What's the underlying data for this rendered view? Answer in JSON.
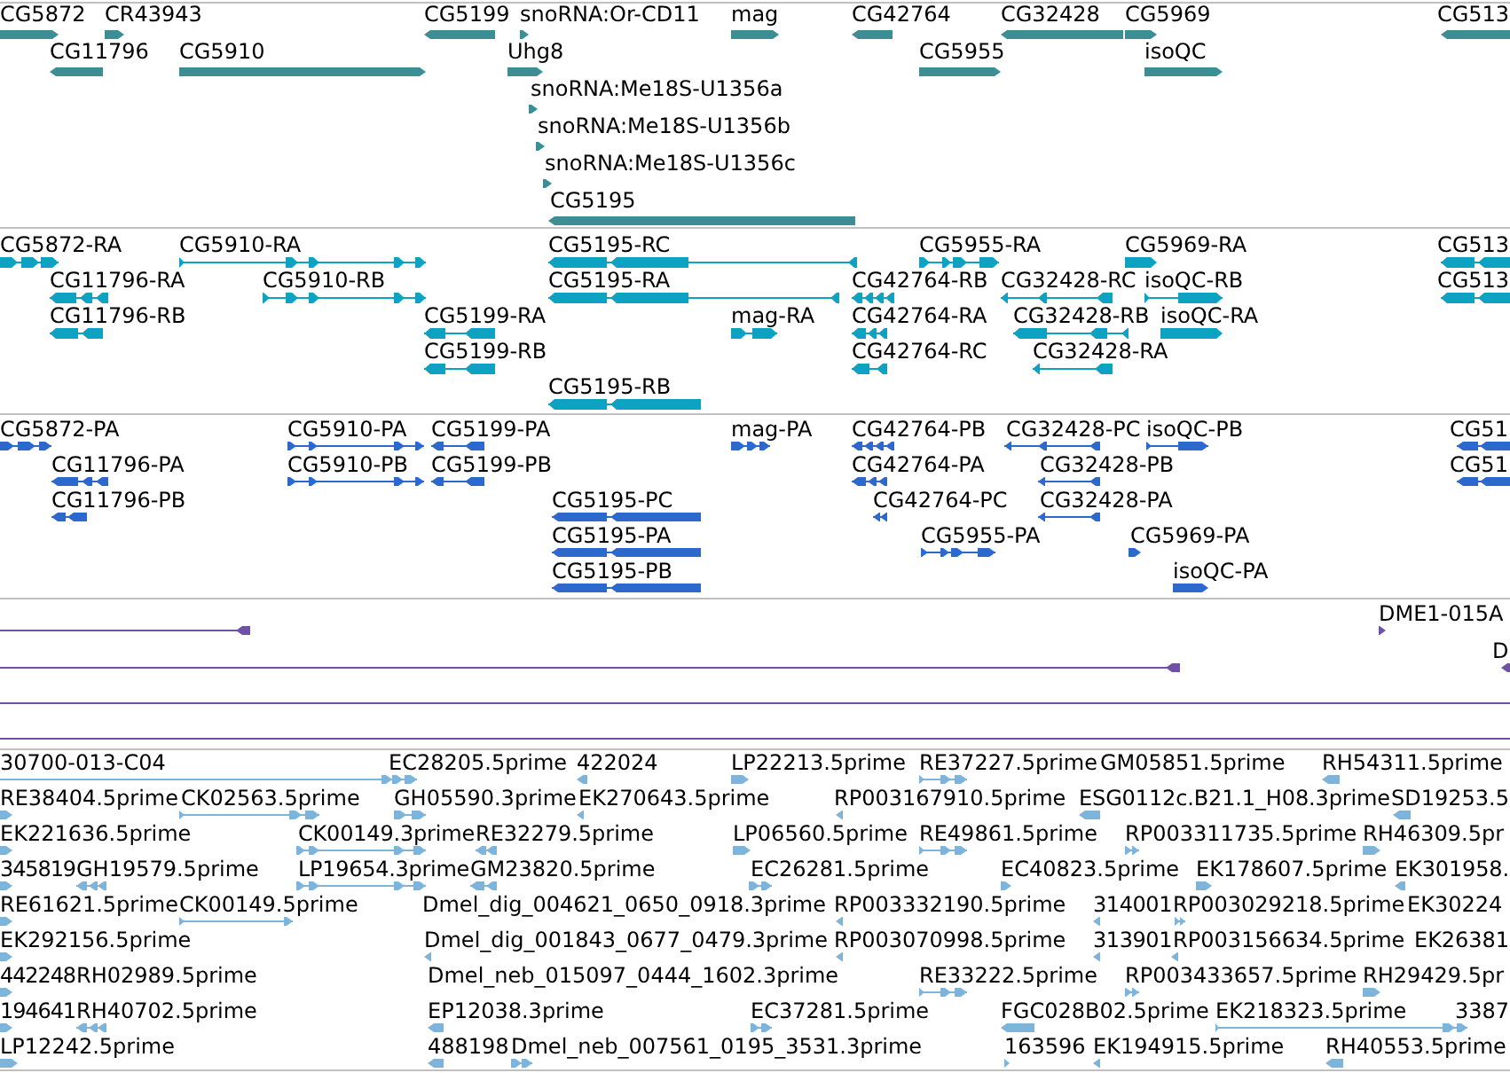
{
  "tracks": [
    {
      "color": "#3d8e94",
      "features": [
        {
          "label": "CG5872",
          "reverse": false
        },
        {
          "label": "CR43943",
          "reverse": false
        },
        {
          "label": "CG5199",
          "reverse": true
        },
        {
          "label": "snoRNA:Or-CD11",
          "reverse": false
        },
        {
          "label": "mag",
          "reverse": false
        },
        {
          "label": "CG42764",
          "reverse": true
        },
        {
          "label": "CG32428",
          "reverse": true
        },
        {
          "label": "CG5969",
          "reverse": false
        },
        {
          "label": "CG513",
          "reverse": true
        },
        {
          "label": "CG11796",
          "reverse": true
        },
        {
          "label": "CG5910",
          "reverse": false
        },
        {
          "label": "Uhg8",
          "reverse": false
        },
        {
          "label": "CG5955",
          "reverse": false
        },
        {
          "label": "isoQC",
          "reverse": false
        },
        {
          "label": "snoRNA:Me18S-U1356a",
          "reverse": false
        },
        {
          "label": "snoRNA:Me18S-U1356b",
          "reverse": false
        },
        {
          "label": "snoRNA:Me18S-U1356c",
          "reverse": false
        },
        {
          "label": "CG5195",
          "reverse": true
        }
      ]
    },
    {
      "color": "#0ea2c2",
      "features": [
        {
          "label": "CG5872-RA",
          "reverse": false
        },
        {
          "label": "CG5910-RA",
          "reverse": false
        },
        {
          "label": "CG5195-RC",
          "reverse": true
        },
        {
          "label": "CG5955-RA",
          "reverse": false
        },
        {
          "label": "CG5969-RA",
          "reverse": false
        },
        {
          "label": "CG513",
          "reverse": true
        },
        {
          "label": "CG11796-RA",
          "reverse": true
        },
        {
          "label": "CG5910-RB",
          "reverse": false
        },
        {
          "label": "CG5195-RA",
          "reverse": true
        },
        {
          "label": "CG42764-RB",
          "reverse": true
        },
        {
          "label": "CG32428-RC",
          "reverse": true
        },
        {
          "label": "isoQC-RB",
          "reverse": false
        },
        {
          "label": "CG513",
          "reverse": true
        },
        {
          "label": "CG11796-RB",
          "reverse": true
        },
        {
          "label": "CG5199-RA",
          "reverse": true
        },
        {
          "label": "mag-RA",
          "reverse": false
        },
        {
          "label": "CG42764-RA",
          "reverse": true
        },
        {
          "label": "CG32428-RB",
          "reverse": true
        },
        {
          "label": "isoQC-RA",
          "reverse": false
        },
        {
          "label": "CG5199-RB",
          "reverse": true
        },
        {
          "label": "CG42764-RC",
          "reverse": true
        },
        {
          "label": "CG32428-RA",
          "reverse": true
        },
        {
          "label": "CG5195-RB",
          "reverse": true
        }
      ]
    },
    {
      "color": "#2d69cd",
      "features": [
        {
          "label": "CG5872-PA",
          "reverse": false
        },
        {
          "label": "CG5910-PA",
          "reverse": false
        },
        {
          "label": "CG5199-PA",
          "reverse": true
        },
        {
          "label": "mag-PA",
          "reverse": false
        },
        {
          "label": "CG42764-PB",
          "reverse": true
        },
        {
          "label": "CG32428-PC",
          "reverse": true
        },
        {
          "label": "isoQC-PB",
          "reverse": false
        },
        {
          "label": "CG51",
          "reverse": true
        },
        {
          "label": "CG11796-PA",
          "reverse": true
        },
        {
          "label": "CG5910-PB",
          "reverse": false
        },
        {
          "label": "CG5199-PB",
          "reverse": true
        },
        {
          "label": "CG42764-PA",
          "reverse": true
        },
        {
          "label": "CG32428-PB",
          "reverse": true
        },
        {
          "label": "CG51",
          "reverse": true
        },
        {
          "label": "CG11796-PB",
          "reverse": true
        },
        {
          "label": "CG5195-PC",
          "reverse": true
        },
        {
          "label": "CG42764-PC",
          "reverse": true
        },
        {
          "label": "CG32428-PA",
          "reverse": true
        },
        {
          "label": "CG5195-PA",
          "reverse": true
        },
        {
          "label": "CG5955-PA",
          "reverse": false
        },
        {
          "label": "CG5969-PA",
          "reverse": false
        },
        {
          "label": "CG5195-PB",
          "reverse": true
        },
        {
          "label": "isoQC-PA",
          "reverse": false
        }
      ]
    },
    {
      "color": "#7050a8",
      "features": [
        {
          "reverse": true
        },
        {
          "label": "DME1-015A",
          "reverse": false
        },
        {
          "reverse": true
        },
        {
          "label": "D",
          "reverse": true
        }
      ]
    },
    {
      "color": "#7db4dc",
      "features": [
        {
          "label": "30700-013-C04",
          "reverse": false
        },
        {
          "label": "EC28205.5prime"
        },
        {
          "label": "422024",
          "reverse": true
        },
        {
          "label": "LP22213.5prime",
          "reverse": false
        },
        {
          "label": "RE37227.5prime",
          "reverse": false
        },
        {
          "label": "GM05851.5prime"
        },
        {
          "label": "RH54311.5prime",
          "reverse": true
        },
        {
          "label": "RE38404.5prime",
          "reverse": false
        },
        {
          "label": "CK02563.5prime",
          "reverse": false
        },
        {
          "label": "GH05590.3prime",
          "reverse": false
        },
        {
          "label": "EK270643.5prime",
          "reverse": true
        },
        {
          "label": "RP003167910.5prime",
          "reverse": true
        },
        {
          "label": "ESG0112c.B21.1_H08.3prime",
          "reverse": true
        },
        {
          "label": "SD19253.5",
          "reverse": true
        },
        {
          "label": "EK221636.5prime",
          "reverse": false
        },
        {
          "label": "CK00149.3prime",
          "reverse": false
        },
        {
          "label": "RE32279.5prime",
          "reverse": true
        },
        {
          "label": "LP06560.5prime",
          "reverse": false
        },
        {
          "label": "RE49861.5prime",
          "reverse": false
        },
        {
          "label": "RP003311735.5prime",
          "reverse": false
        },
        {
          "label": "RH46309.5pr",
          "reverse": false
        },
        {
          "label": "345819",
          "reverse": false
        },
        {
          "label": "GH19579.5prime",
          "reverse": true
        },
        {
          "label": "LP19654.3prime",
          "reverse": false
        },
        {
          "label": "GM23820.5prime",
          "reverse": true
        },
        {
          "label": "EC26281.5prime",
          "reverse": false
        },
        {
          "label": "EC40823.5prime",
          "reverse": false
        },
        {
          "label": "EK178607.5prime",
          "reverse": false
        },
        {
          "label": "EK301958.",
          "reverse": true
        },
        {
          "label": "RE61621.5prime",
          "reverse": false
        },
        {
          "label": "CK00149.5prime",
          "reverse": false
        },
        {
          "label": "Dmel_dig_004621_0650_0918.3prime"
        },
        {
          "label": "RP003332190.5prime",
          "reverse": true
        },
        {
          "label": "314001",
          "reverse": true
        },
        {
          "label": "RP003029218.5prime",
          "reverse": false
        },
        {
          "label": "EK30224"
        },
        {
          "label": "EK292156.5prime",
          "reverse": false
        },
        {
          "label": "Dmel_dig_001843_0677_0479.3prime",
          "reverse": true
        },
        {
          "label": "RP003070998.5prime",
          "reverse": true
        },
        {
          "label": "313901",
          "reverse": true
        },
        {
          "label": "RP003156634.5prime",
          "reverse": true
        },
        {
          "label": "EK26381"
        },
        {
          "label": "442248",
          "reverse": false
        },
        {
          "label": "RH02989.5prime"
        },
        {
          "label": "Dmel_neb_015097_0444_1602.3prime"
        },
        {
          "label": "RE33222.5prime",
          "reverse": false
        },
        {
          "label": "RP003433657.5prime",
          "reverse": false
        },
        {
          "label": "RH29429.5pr",
          "reverse": false
        },
        {
          "label": "194641",
          "reverse": false
        },
        {
          "label": "RH40702.5prime",
          "reverse": true
        },
        {
          "label": "EP12038.3prime",
          "reverse": true
        },
        {
          "label": "EC37281.5prime",
          "reverse": false
        },
        {
          "label": "FGC028B02.5prime",
          "reverse": true
        },
        {
          "label": "EK218323.5prime",
          "reverse": false
        },
        {
          "label": "3387"
        },
        {
          "label": "LP12242.5prime",
          "reverse": false
        },
        {
          "label": "488198",
          "reverse": true
        },
        {
          "label": "Dmel_neb_007561_0195_3531.3prime",
          "reverse": false
        },
        {
          "label": "163596",
          "reverse": false
        },
        {
          "label": "EK194915.5prime",
          "reverse": true
        },
        {
          "label": "RH40553.5prime",
          "reverse": true
        }
      ]
    }
  ]
}
